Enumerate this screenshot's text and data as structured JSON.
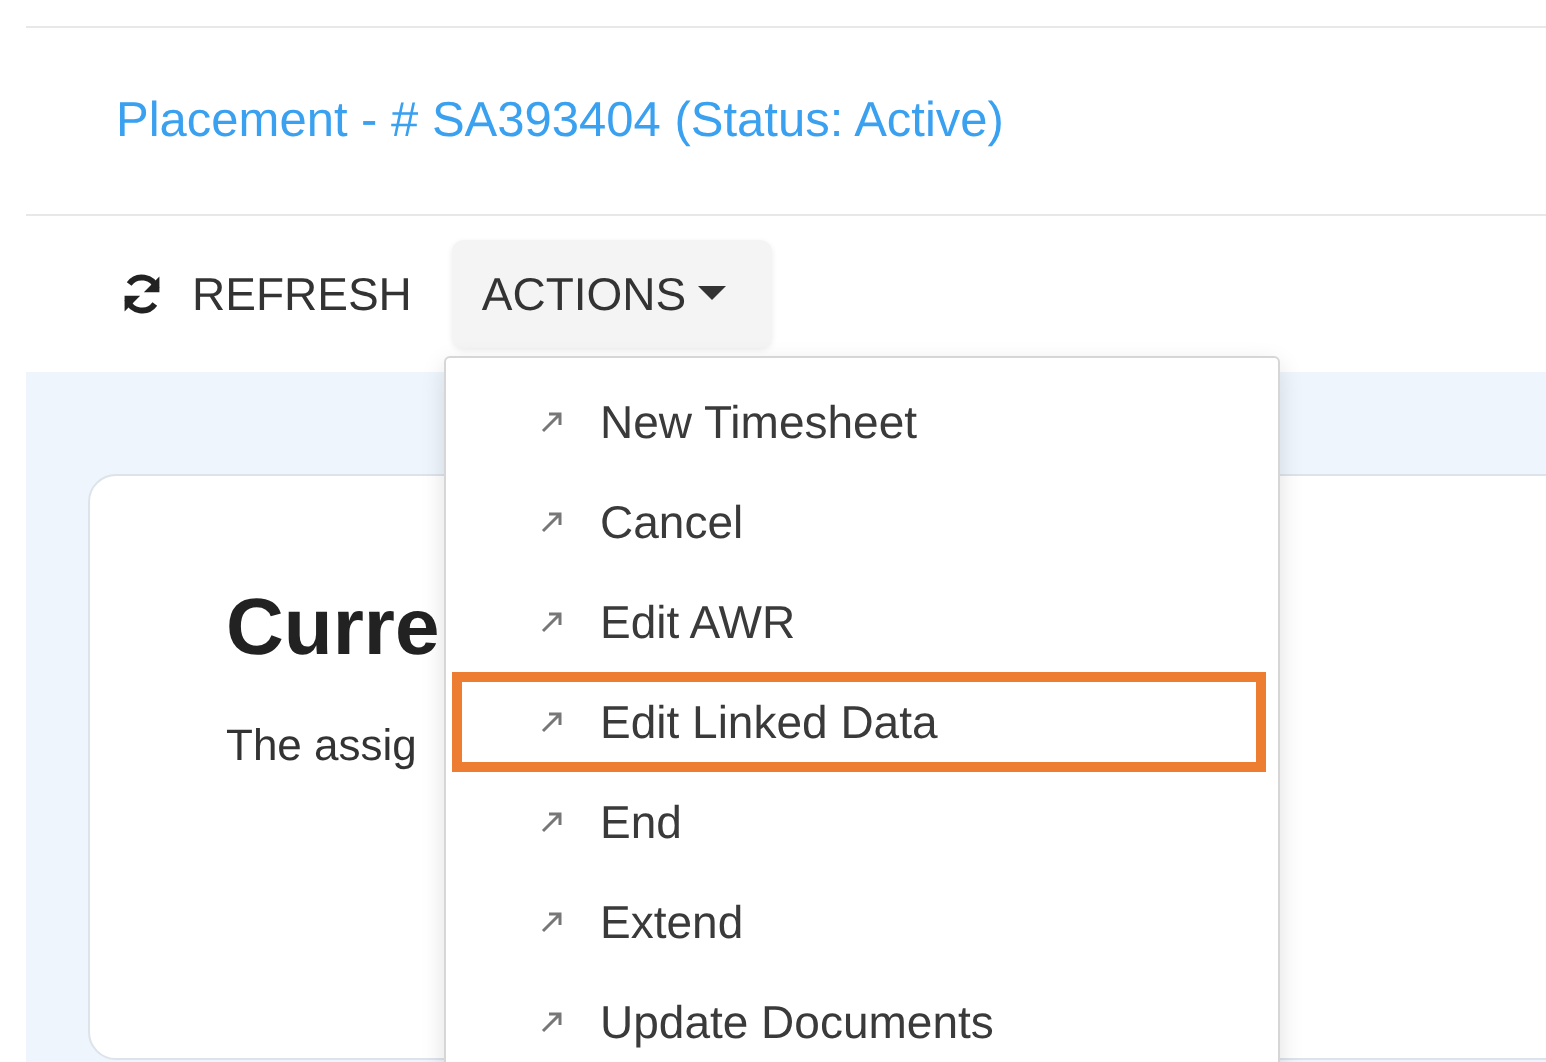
{
  "header": {
    "title": "Placement - # SA393404 (Status: Active)"
  },
  "toolbar": {
    "refresh_label": "REFRESH",
    "actions_label": "ACTIONS"
  },
  "actions_menu": {
    "expanded": true,
    "items": [
      {
        "label": "New Timesheet",
        "highlighted": false
      },
      {
        "label": "Cancel",
        "highlighted": false
      },
      {
        "label": "Edit AWR",
        "highlighted": false
      },
      {
        "label": "Edit Linked Data",
        "highlighted": true
      },
      {
        "label": "End",
        "highlighted": false
      },
      {
        "label": "Extend",
        "highlighted": false
      },
      {
        "label": "Update Documents",
        "highlighted": false
      }
    ]
  },
  "card": {
    "heading": "Curre",
    "text": "The assig"
  }
}
